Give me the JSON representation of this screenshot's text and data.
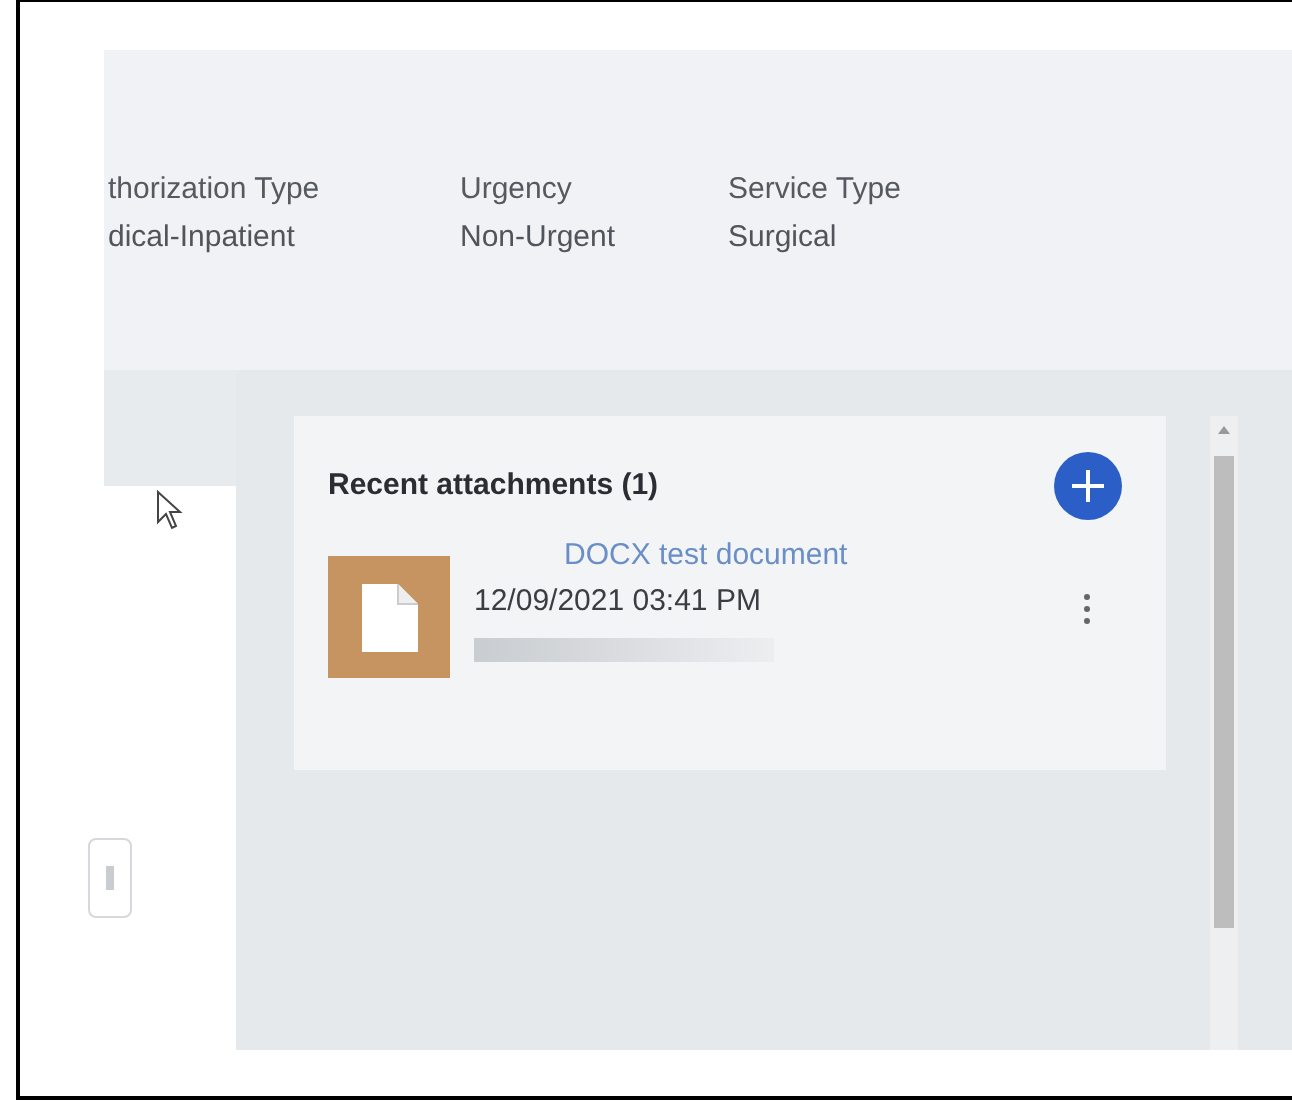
{
  "header": {
    "fields": [
      {
        "label": "thorization Type",
        "value": "dical-Inpatient"
      },
      {
        "label": "Urgency",
        "value": "Non-Urgent"
      },
      {
        "label": "Service Type",
        "value": "Surgical"
      }
    ]
  },
  "attachments": {
    "title": "Recent attachments (1)",
    "items": [
      {
        "name": "DOCX test document",
        "timestamp": "12/09/2021 03:41 PM"
      }
    ]
  }
}
